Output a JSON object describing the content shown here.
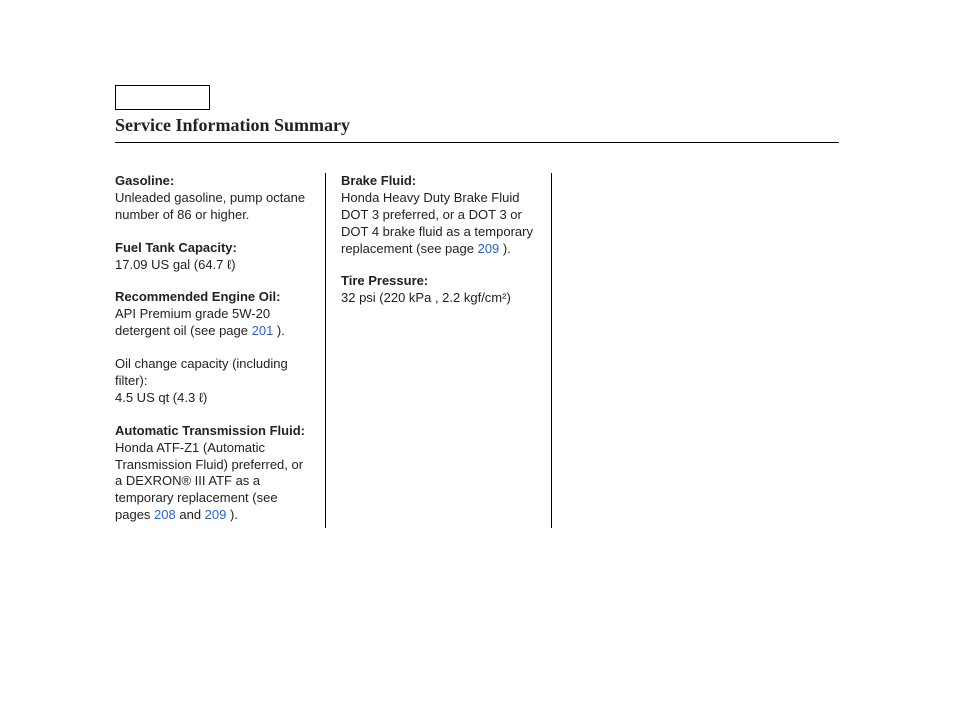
{
  "header": {
    "title": "Service Information Summary"
  },
  "col1": {
    "gasoline": {
      "label": "Gasoline:",
      "text": "Unleaded gasoline, pump octane number of 86 or higher."
    },
    "fuel_tank": {
      "label": "Fuel Tank Capacity:",
      "text": "17.09 US gal (64.7 ℓ)"
    },
    "engine_oil": {
      "label": "Recommended Engine Oil:",
      "text_before": "API Premium grade 5W-20 detergent oil (see page ",
      "link": "201",
      "text_after": " )."
    },
    "oil_change": {
      "text": "Oil change capacity (including filter):",
      "value": "4.5 US qt (4.3 ℓ)"
    },
    "atf": {
      "label": "Automatic Transmission Fluid:",
      "text_before": "Honda ATF-Z1 (Automatic Transmission Fluid) preferred, or a DEXRON® III ATF as a temporary replacement (see pages ",
      "link1": "208",
      "mid": " and ",
      "link2": "209",
      "text_after": " )."
    }
  },
  "col2": {
    "brake": {
      "label": "Brake Fluid:",
      "text_before": "Honda Heavy Duty Brake Fluid DOT 3 preferred, or a DOT 3 or DOT 4 brake fluid as a temporary replacement (see page ",
      "link": "209",
      "text_after": " )."
    },
    "tire": {
      "label": "Tire Pressure:",
      "text": "32 psi (220 kPa , 2.2 kgf/cm²)"
    }
  }
}
